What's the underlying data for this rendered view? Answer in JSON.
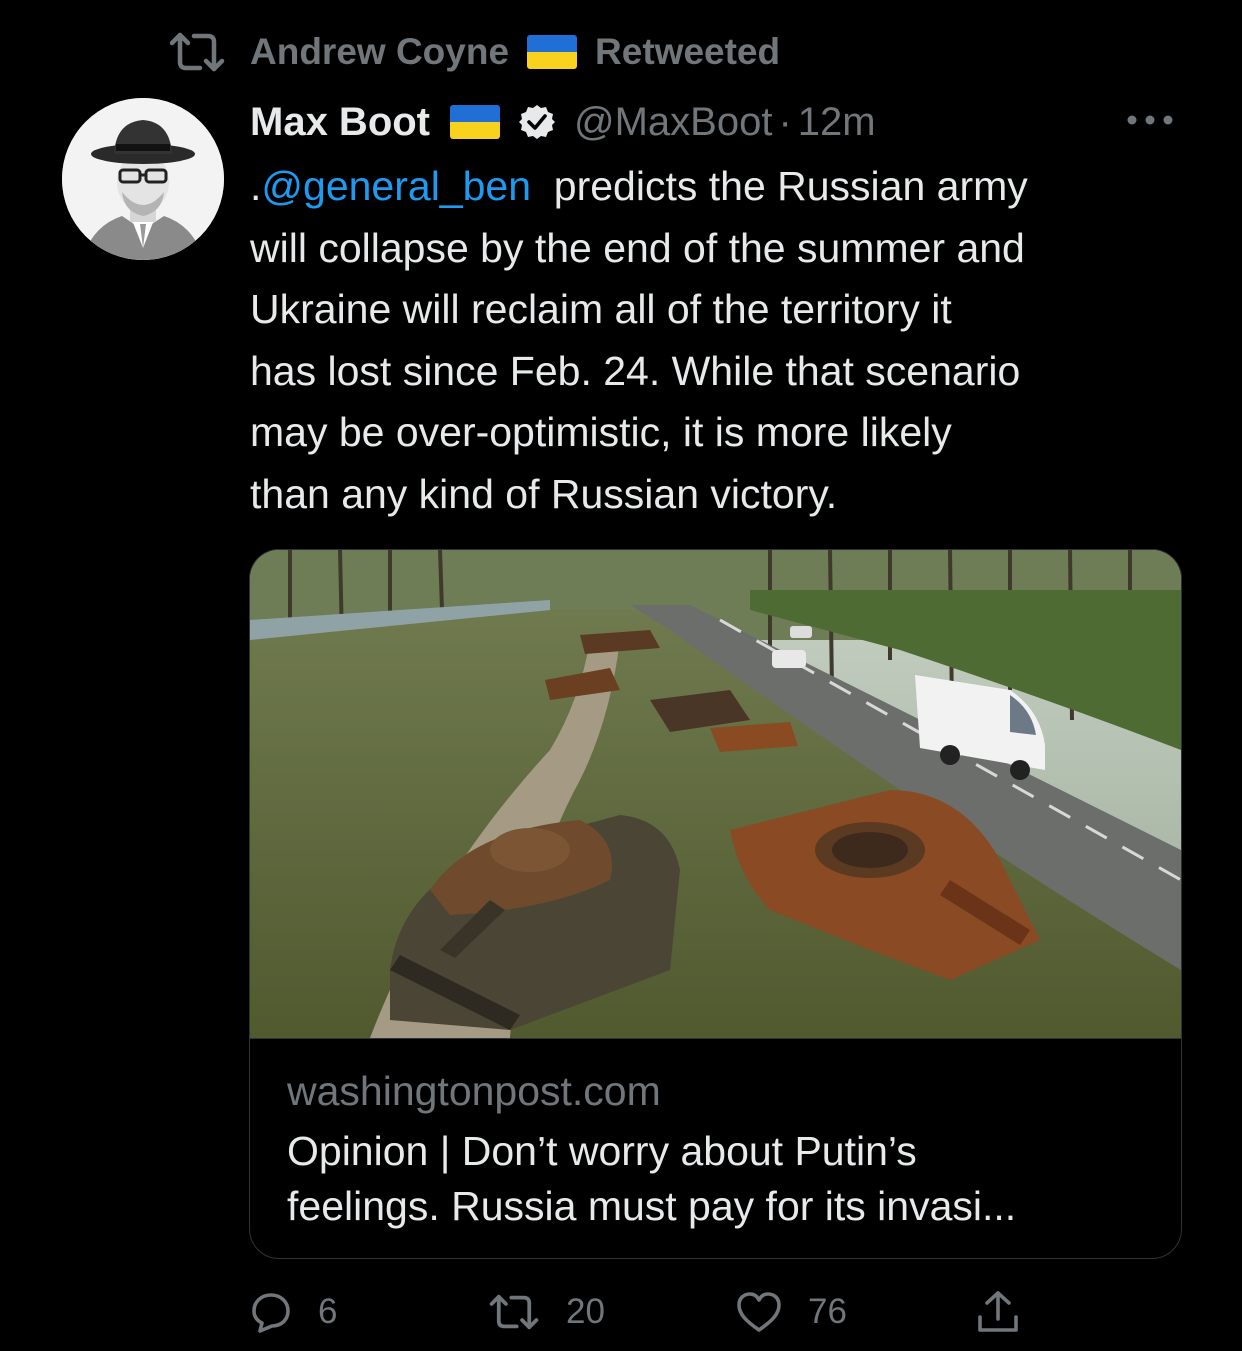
{
  "social_context": {
    "retweeter_name": "Andrew Coyne",
    "action_label": "Retweeted"
  },
  "tweet": {
    "display_name": "Max Boot",
    "handle": "@MaxBoot",
    "separator": "·",
    "time": "12m",
    "text_lines": [
      {
        "prefix": ".",
        "mention": "@general_ben",
        "rest": "  predicts the Russian army"
      },
      "will collapse by the end of the summer and",
      "Ukraine will reclaim all of the territory it",
      "has lost since Feb. 24. While that scenario",
      "may be over-optimistic, it is more likely",
      "than any kind of Russian victory."
    ]
  },
  "card": {
    "domain": "washingtonpost.com",
    "title_lines": [
      "Opinion | Don’t worry about Putin’s",
      "feelings. Russia must pay for its invasi..."
    ]
  },
  "actions": {
    "reply_count": "6",
    "retweet_count": "20",
    "like_count": "76"
  },
  "colors": {
    "background": "#000000",
    "text": "#e7e9ea",
    "secondary": "#71767b",
    "link": "#1d9bf0",
    "flag_blue": "#1f6fd6",
    "flag_yellow": "#f8d21c"
  },
  "icons": {
    "retweet_header": "retweet-icon",
    "verified": "verified-badge-icon",
    "more": "more-horizontal-icon",
    "reply": "reply-icon",
    "retweet": "retweet-icon",
    "like": "heart-icon",
    "share": "share-icon"
  }
}
